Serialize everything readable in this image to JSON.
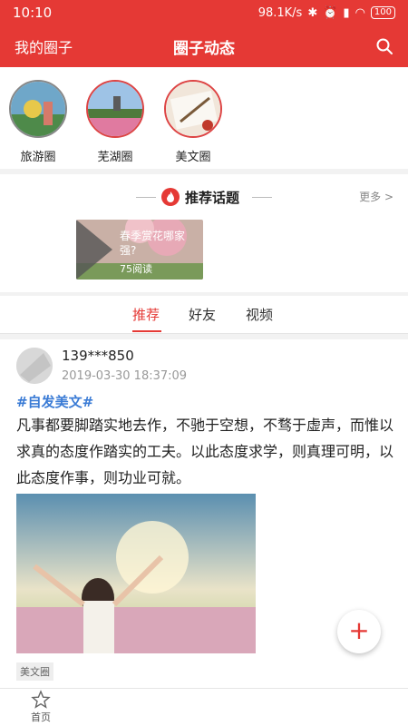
{
  "status": {
    "time": "10:10",
    "network_speed": "98.1K/s",
    "battery": "100"
  },
  "appbar": {
    "left_label": "我的圈子",
    "title": "圈子动态"
  },
  "circles": [
    {
      "label": "旅游圈"
    },
    {
      "label": "芜湖圈"
    },
    {
      "label": "美文圈"
    }
  ],
  "topics": {
    "title": "推荐话题",
    "more": "更多 >",
    "card": {
      "text": "春季赏花哪家强?",
      "reads": "75阅读"
    }
  },
  "tabs": [
    {
      "label": "推荐"
    },
    {
      "label": "好友"
    },
    {
      "label": "视频"
    }
  ],
  "post": {
    "username": "139***850",
    "time": "2019-03-30 18:37:09",
    "hashtag": "#自发美文#",
    "content": "凡事都要脚踏实地去作，不驰于空想，不骛于虚声，而惟以求真的态度作踏实的工夫。以此态度求学，则真理可明，以此态度作事，则功业可就。",
    "tag": "美文圈"
  },
  "fab": {
    "label": "+"
  },
  "bottomnav": {
    "home_label": "首页"
  },
  "colors": {
    "brand": "#e53935",
    "hashtag": "#3a7bd5"
  }
}
